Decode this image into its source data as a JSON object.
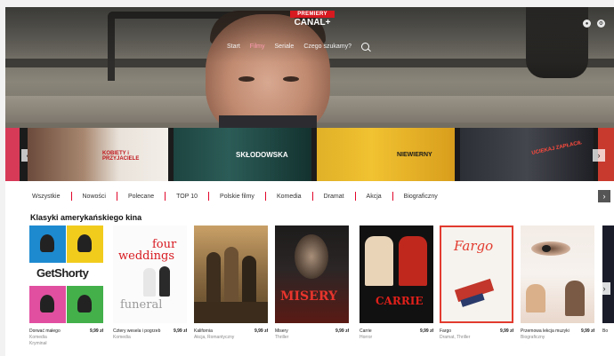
{
  "brand": {
    "badge": "PREMIERY",
    "name": "CANAL+"
  },
  "nav": {
    "items": [
      "Start",
      "Filmy",
      "Seriale",
      "Czego szukamy?"
    ]
  },
  "carousel": {
    "tiles": [
      {
        "title": "KOBIETY i PRZYJACIELE"
      },
      {
        "title": "SKŁODOWSKA"
      },
      {
        "title": "NIEWIERNY"
      },
      {
        "title": "UCIEKAJ ZAPŁACIŁ"
      }
    ]
  },
  "categories": [
    "Wszystkie",
    "Nowości",
    "Polecane",
    "TOP 10",
    "Polskie filmy",
    "Komedia",
    "Dramat",
    "Akcja",
    "Biograficzny"
  ],
  "section": {
    "title": "Klasyki amerykańskiego kina"
  },
  "movies": [
    {
      "title": "Dorwać małego",
      "price": "9,99 zł",
      "genre": "Komedia",
      "genre2": "Kryminał",
      "poster": {
        "line1": "Get",
        "line2": "Shorty"
      }
    },
    {
      "title": "Cztery wesela i pogrzeb",
      "price": "9,99 zł",
      "genre": "Komedia",
      "poster": {
        "line1": "four",
        "line2": "weddings",
        "line3": "funeral"
      }
    },
    {
      "title": "Kalifornia",
      "price": "9,99 zł",
      "genre": "Akcja, Romantyczny"
    },
    {
      "title": "Misery",
      "price": "9,99 zł",
      "genre": "Thriller",
      "poster": {
        "line1": "MISERY"
      }
    },
    {
      "title": "Carrie",
      "price": "9,99 zł",
      "genre": "Horror",
      "poster": {
        "line1": "CARRIE"
      }
    },
    {
      "title": "Fargo",
      "price": "9,99 zł",
      "genre": "Dramat, Thriller",
      "poster": {
        "line1": "Fargo"
      }
    },
    {
      "title": "Przemowa lekcja muzyki",
      "price": "9,99 zł",
      "genre": "Biograficzny"
    },
    {
      "title": "Bo",
      "price": "",
      "genre": ""
    }
  ]
}
